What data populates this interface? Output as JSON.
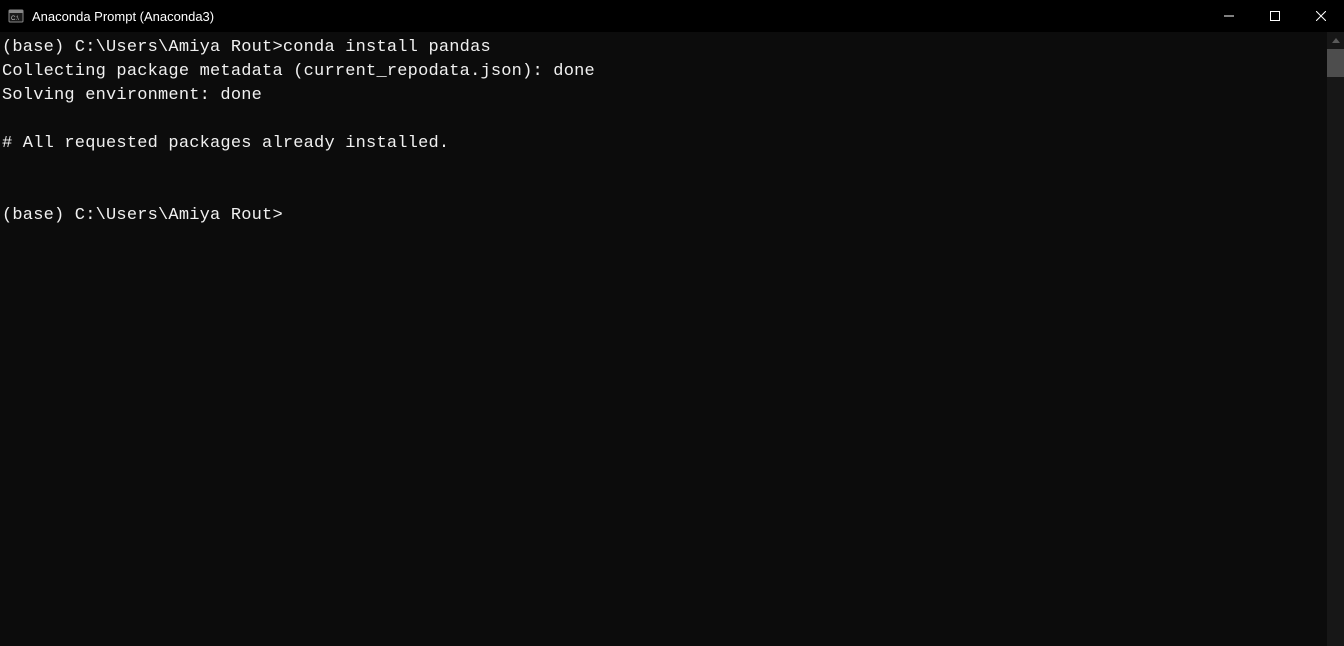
{
  "window": {
    "title": "Anaconda Prompt (Anaconda3)"
  },
  "terminal": {
    "lines": [
      "(base) C:\\Users\\Amiya Rout>conda install pandas",
      "Collecting package metadata (current_repodata.json): done",
      "Solving environment: done",
      "",
      "# All requested packages already installed.",
      "",
      "",
      "(base) C:\\Users\\Amiya Rout>"
    ]
  }
}
